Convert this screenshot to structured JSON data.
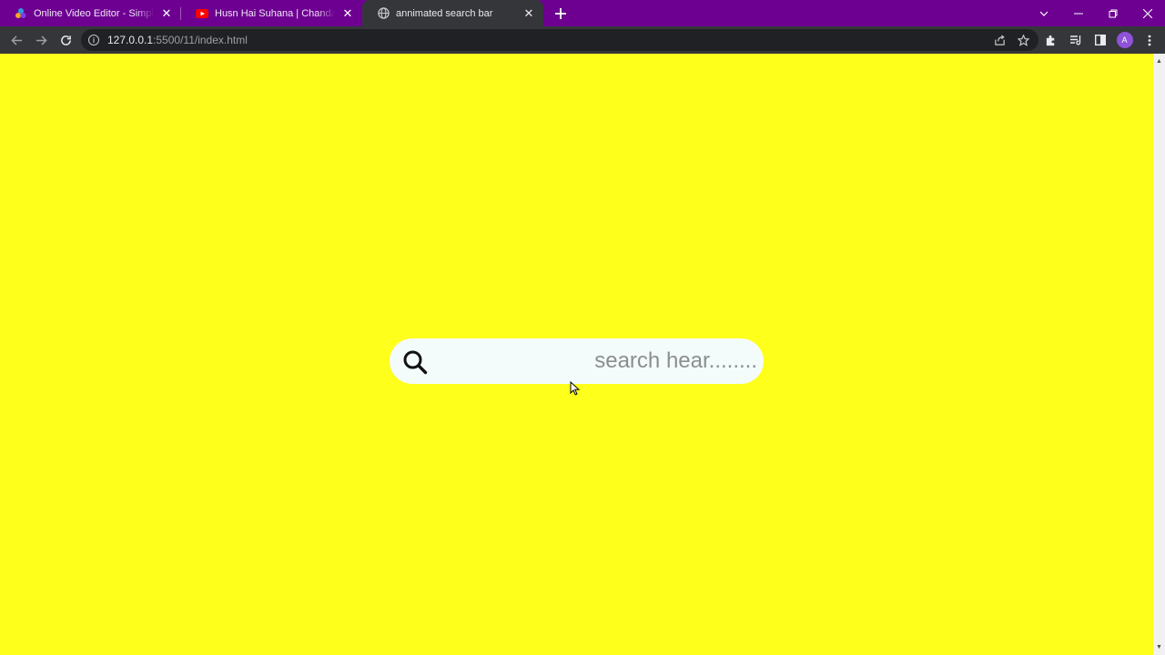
{
  "browser": {
    "tabs": [
      {
        "title": "Online Video Editor - Simple & Free",
        "icon": "clipchamp-icon",
        "active": false
      },
      {
        "title": "Husn Hai Suhana | Chandana Dixit",
        "icon": "youtube-icon",
        "active": false
      },
      {
        "title": "annimated search bar",
        "icon": "globe-icon",
        "active": true
      }
    ],
    "address": {
      "host": "127.0.0.1",
      "rest": ":5500/11/index.html"
    },
    "profile_initial": "A",
    "accent_color": "#6d0091"
  },
  "page": {
    "background_color": "#ffff1c",
    "search": {
      "placeholder": "search hear........",
      "value": "",
      "icon": "search-icon"
    }
  }
}
